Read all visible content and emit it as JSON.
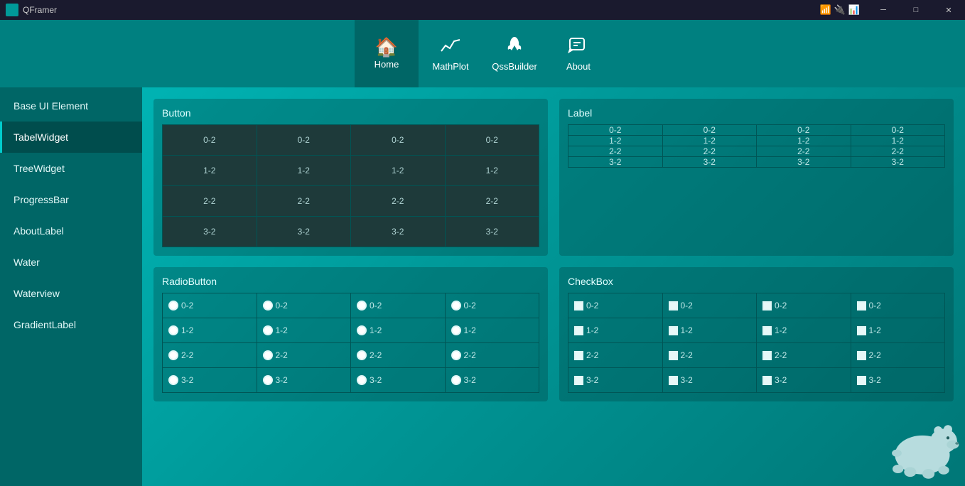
{
  "titlebar": {
    "app_name": "QFramer",
    "controls": [
      "minimize",
      "maximize",
      "close"
    ]
  },
  "navbar": {
    "items": [
      {
        "id": "home",
        "label": "Home",
        "icon": "🏠",
        "active": true
      },
      {
        "id": "mathplot",
        "label": "MathPlot",
        "icon": "📈",
        "active": false
      },
      {
        "id": "qssbuilder",
        "label": "QssBuilder",
        "icon": "🌿",
        "active": false
      },
      {
        "id": "about",
        "label": "About",
        "icon": "💬",
        "active": false
      }
    ]
  },
  "sidebar": {
    "items": [
      {
        "id": "base-ui-element",
        "label": "Base UI Element",
        "active": false
      },
      {
        "id": "tabel-widget",
        "label": "TabelWidget",
        "active": true
      },
      {
        "id": "tree-widget",
        "label": "TreeWidget",
        "active": false
      },
      {
        "id": "progress-bar",
        "label": "ProgressBar",
        "active": false
      },
      {
        "id": "about-label",
        "label": "AboutLabel",
        "active": false
      },
      {
        "id": "water",
        "label": "Water",
        "active": false
      },
      {
        "id": "waterview",
        "label": "Waterview",
        "active": false
      },
      {
        "id": "gradient-label",
        "label": "GradientLabel",
        "active": false
      }
    ]
  },
  "panels": {
    "button_panel": {
      "title": "Button",
      "rows": [
        [
          "0-2",
          "0-2",
          "0-2",
          "0-2"
        ],
        [
          "1-2",
          "1-2",
          "1-2",
          "1-2"
        ],
        [
          "2-2",
          "2-2",
          "2-2",
          "2-2"
        ],
        [
          "3-2",
          "3-2",
          "3-2",
          "3-2"
        ]
      ]
    },
    "label_panel": {
      "title": "Label",
      "rows": [
        [
          "0-2",
          "0-2",
          "0-2",
          "0-2"
        ],
        [
          "1-2",
          "1-2",
          "1-2",
          "1-2"
        ],
        [
          "2-2",
          "2-2",
          "2-2",
          "2-2"
        ],
        [
          "3-2",
          "3-2",
          "3-2",
          "3-2"
        ]
      ]
    },
    "radio_panel": {
      "title": "RadioButton",
      "rows": [
        [
          "0-2",
          "0-2",
          "0-2",
          "0-2"
        ],
        [
          "1-2",
          "1-2",
          "1-2",
          "1-2"
        ],
        [
          "2-2",
          "2-2",
          "2-2",
          "2-2"
        ],
        [
          "3-2",
          "3-2",
          "3-2",
          "3-2"
        ]
      ]
    },
    "checkbox_panel": {
      "title": "CheckBox",
      "rows": [
        [
          "0-2",
          "0-2",
          "0-2",
          "0-2"
        ],
        [
          "1-2",
          "1-2",
          "1-2",
          "1-2"
        ],
        [
          "2-2",
          "2-2",
          "2-2",
          "2-2"
        ],
        [
          "3-2",
          "3-2",
          "3-2",
          "3-2"
        ]
      ]
    }
  }
}
